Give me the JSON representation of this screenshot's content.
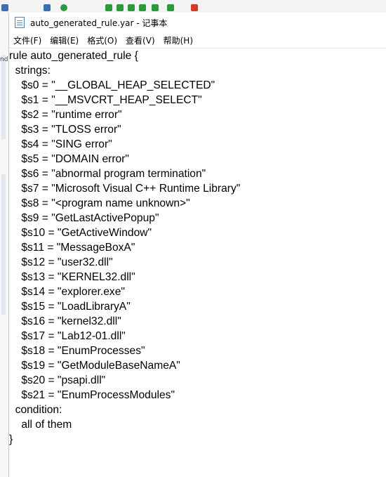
{
  "window": {
    "title": "auto_generated_rule.yar - 记事本",
    "icon": "notepad-icon"
  },
  "menu": [
    {
      "label": "文件(F)"
    },
    {
      "label": "编辑(E)"
    },
    {
      "label": "格式(O)"
    },
    {
      "label": "查看(V)"
    },
    {
      "label": "帮助(H)"
    }
  ],
  "background": {
    "left_edge_text": "nd"
  },
  "editor": {
    "lines": [
      "rule auto_generated_rule {",
      "  strings:",
      "    $s0 = \"__GLOBAL_HEAP_SELECTED\"",
      "    $s1 = \"__MSVCRT_HEAP_SELECT\"",
      "    $s2 = \"runtime error\"",
      "    $s3 = \"TLOSS error\"",
      "    $s4 = \"SING error\"",
      "    $s5 = \"DOMAIN error\"",
      "    $s6 = \"abnormal program termination\"",
      "    $s7 = \"Microsoft Visual C++ Runtime Library\"",
      "    $s8 = \"<program name unknown>\"",
      "    $s9 = \"GetLastActivePopup\"",
      "    $s10 = \"GetActiveWindow\"",
      "    $s11 = \"MessageBoxA\"",
      "    $s12 = \"user32.dll\"",
      "    $s13 = \"KERNEL32.dll\"",
      "    $s14 = \"explorer.exe\"",
      "    $s15 = \"LoadLibraryA\"",
      "    $s16 = \"kernel32.dll\"",
      "    $s17 = \"Lab12-01.dll\"",
      "    $s18 = \"EnumProcesses\"",
      "    $s19 = \"GetModuleBaseNameA\"",
      "    $s20 = \"psapi.dll\"",
      "    $s21 = \"EnumProcessModules\"",
      "  condition:",
      "    all of them",
      "}"
    ]
  }
}
